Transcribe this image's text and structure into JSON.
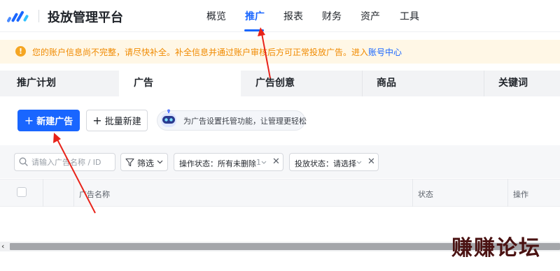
{
  "header": {
    "app_title": "投放管理平台",
    "nav": [
      {
        "label": "概览"
      },
      {
        "label": "推广"
      },
      {
        "label": "报表"
      },
      {
        "label": "财务"
      },
      {
        "label": "资产"
      },
      {
        "label": "工具"
      }
    ],
    "active_nav": "推广"
  },
  "notice": {
    "icon": "!",
    "text": "您的账户信息尚不完整，请尽快补全。补全信息并通过账户审核后方可正常投放广告。进入",
    "link": "账号中心"
  },
  "tabs": [
    {
      "label": "推广计划"
    },
    {
      "label": "广告"
    },
    {
      "label": "广告创意"
    },
    {
      "label": "商品"
    },
    {
      "label": "关键词"
    }
  ],
  "active_tab": "广告",
  "actions": {
    "new_ad": "新建广告",
    "batch_new": "批量新建",
    "assistant_text": "为广告设置托管功能，让管理更轻松"
  },
  "filters": {
    "search_placeholder": "请输入广告名称 / ID",
    "filter_label": "筛选",
    "chip_status": "操作状态：所有未删除",
    "chip_status_extra": "1",
    "chip_delivery": "投放状态：请选择"
  },
  "table": {
    "columns": [
      "广告名称",
      "状态",
      "操作"
    ]
  },
  "watermark": "赚赚论坛",
  "colors": {
    "accent": "#1966ff",
    "notice_bg": "#fff7e6",
    "notice_text": "#f08a00",
    "arrow": "#e8231a"
  }
}
